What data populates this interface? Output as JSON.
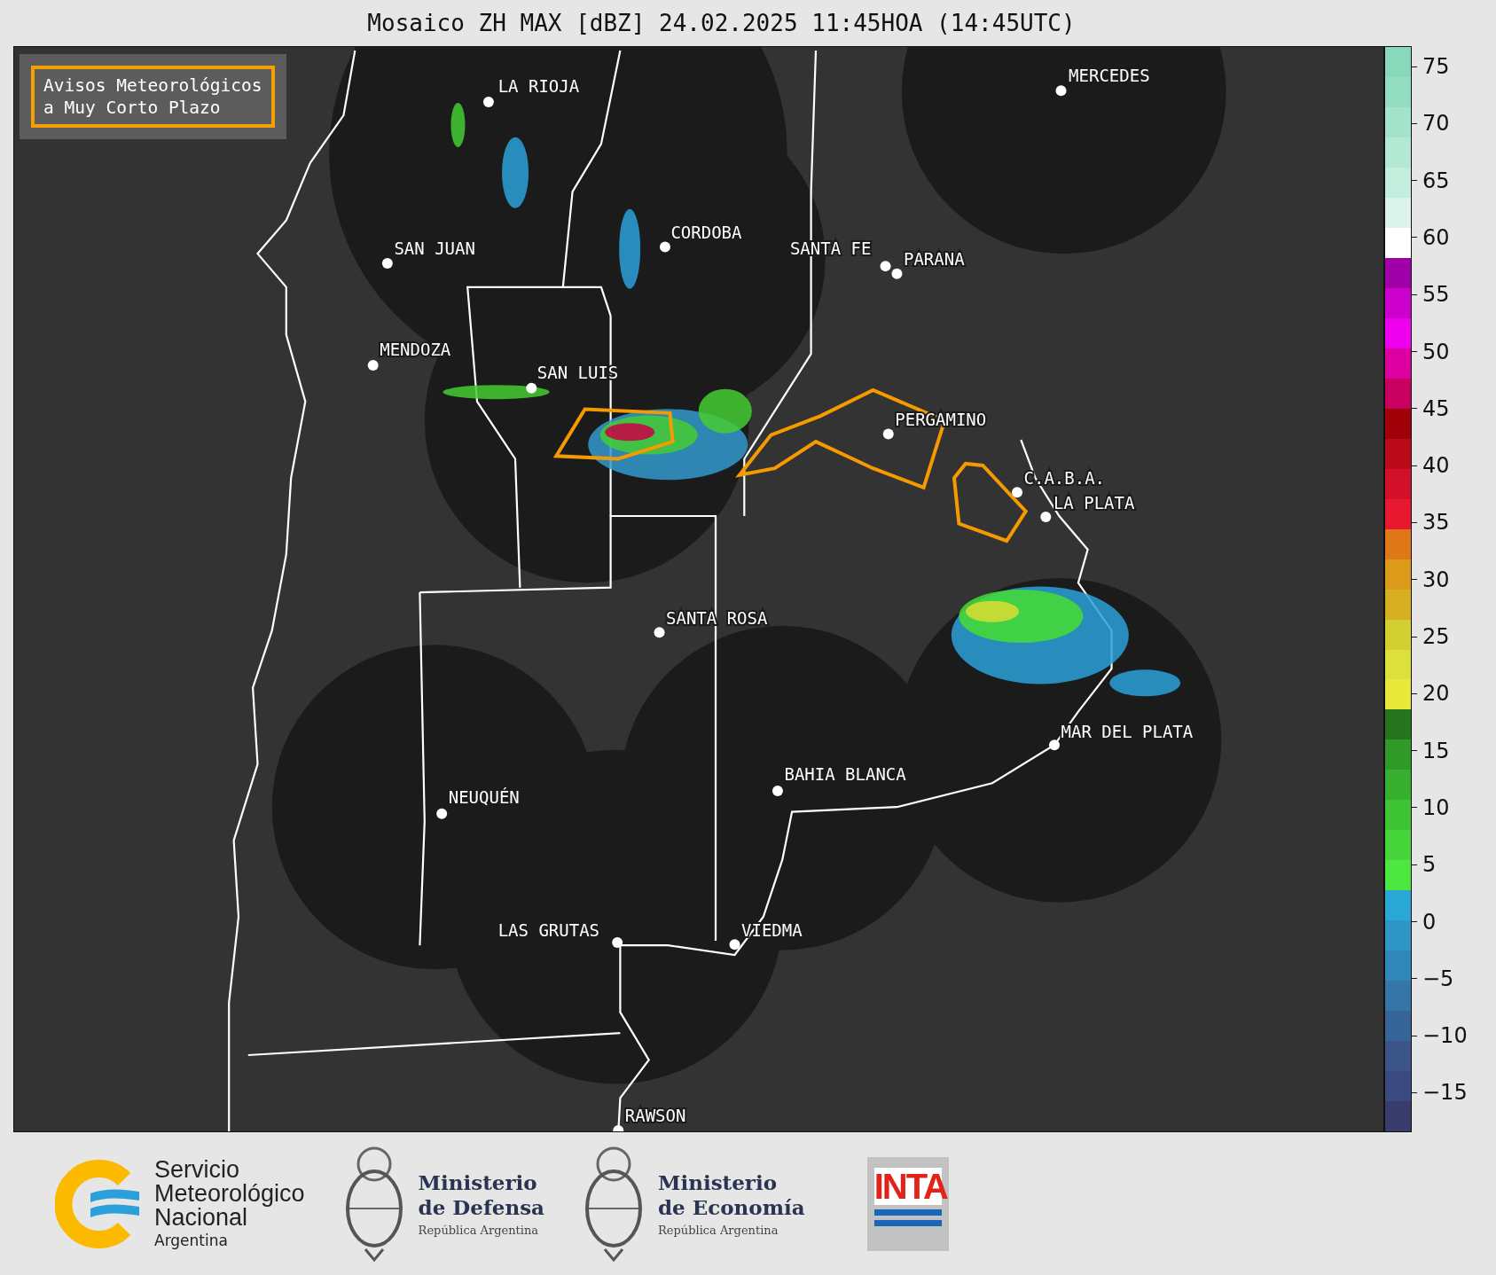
{
  "title": "Mosaico ZH MAX [dBZ] 24.02.2025 11:45HOA (14:45UTC)",
  "legend_box": {
    "lines": [
      "Avisos Meteorológicos",
      "a Muy Corto Plazo"
    ]
  },
  "map": {
    "cities": [
      {
        "name": "LA RIOJA"
      },
      {
        "name": "MERCEDES"
      },
      {
        "name": "CORDOBA"
      },
      {
        "name": "SAN JUAN"
      },
      {
        "name": "SANTA FE"
      },
      {
        "name": "PARANA"
      },
      {
        "name": "MENDOZA"
      },
      {
        "name": "SAN LUIS"
      },
      {
        "name": "PERGAMINO"
      },
      {
        "name": "C.A.B.A."
      },
      {
        "name": "LA PLATA"
      },
      {
        "name": "SANTA ROSA"
      },
      {
        "name": "MAR DEL PLATA"
      },
      {
        "name": "BAHIA BLANCA"
      },
      {
        "name": "NEUQUÉN"
      },
      {
        "name": "LAS GRUTAS"
      },
      {
        "name": "VIEDMA"
      },
      {
        "name": "RAWSON"
      }
    ]
  },
  "colorbar": {
    "ticks": [
      "75",
      "70",
      "65",
      "60",
      "55",
      "50",
      "45",
      "40",
      "35",
      "30",
      "25",
      "20",
      "15",
      "10",
      "5",
      "0",
      "−5",
      "−10",
      "−15"
    ]
  },
  "footer": {
    "smn": {
      "lines": [
        "Servicio",
        "Meteorológico",
        "Nacional"
      ],
      "country": "Argentina"
    },
    "defensa": {
      "lines": [
        "Ministerio",
        "de Defensa"
      ],
      "sub": "República Argentina"
    },
    "economia": {
      "lines": [
        "Ministerio",
        "de Economía"
      ],
      "sub": "República Argentina"
    },
    "inta": {
      "label": "INTA"
    }
  }
}
